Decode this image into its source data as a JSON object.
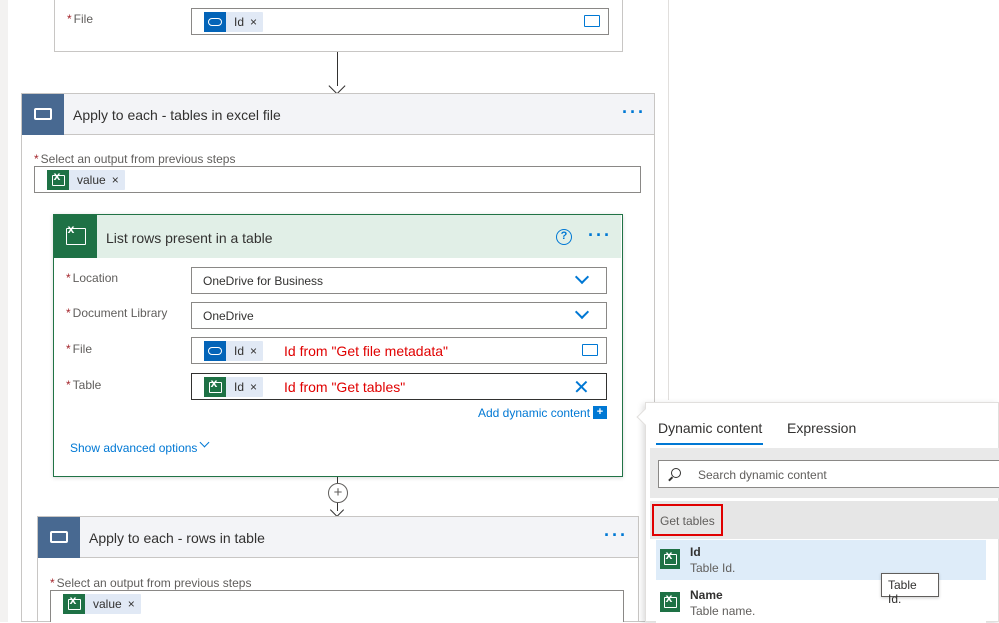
{
  "top_card": {
    "file_label": "File",
    "file_token": "Id",
    "token_close": "×"
  },
  "loop1": {
    "title": "Apply to each - tables in excel file",
    "more": "···",
    "select_label": "Select an output from previous steps",
    "token": "value",
    "token_close": "×"
  },
  "action": {
    "title": "List rows present in a table",
    "help": "?",
    "more": "···",
    "location_label": "Location",
    "location_value": "OneDrive for Business",
    "doclib_label": "Document Library",
    "doclib_value": "OneDrive",
    "file_label": "File",
    "file_token": "Id",
    "file_note": "Id from \"Get file metadata\"",
    "table_label": "Table",
    "table_token": "Id",
    "table_note": "Id from \"Get tables\"",
    "token_close": "×",
    "add_dynamic": "Add dynamic content",
    "show_advanced": "Show advanced options"
  },
  "loop2": {
    "title": "Apply to each - rows in table",
    "more": "···",
    "select_label": "Select an output from previous steps",
    "token": "value",
    "token_close": "×"
  },
  "dynamic_panel": {
    "tab_dynamic": "Dynamic content",
    "tab_expression": "Expression",
    "search_placeholder": "Search dynamic content",
    "group_title": "Get tables",
    "items": [
      {
        "title": "Id",
        "desc": "Table Id."
      },
      {
        "title": "Name",
        "desc": "Table name."
      }
    ],
    "tooltip": "Table Id."
  },
  "colors": {
    "accent": "#0078d4",
    "excel": "#1e7145",
    "loop_header": "#486991",
    "highlight_red": "#e00000"
  }
}
